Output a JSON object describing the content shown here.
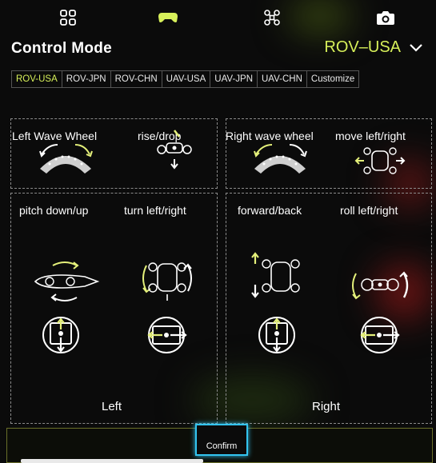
{
  "header": {
    "title": "Control Mode",
    "mode_value": "ROV–USA"
  },
  "top_icons": [
    "grid-icon",
    "gamepad-icon",
    "drone-icon",
    "camera-icon"
  ],
  "tabs": [
    {
      "label": "ROV-USA",
      "active": true
    },
    {
      "label": "ROV-JPN",
      "active": false
    },
    {
      "label": "ROV-CHN",
      "active": false
    },
    {
      "label": "UAV-USA",
      "active": false
    },
    {
      "label": "UAV-JPN",
      "active": false
    },
    {
      "label": "UAV-CHN",
      "active": false
    },
    {
      "label": "Customize",
      "active": false
    }
  ],
  "top_left_box": {
    "label_1": "Left Wave Wheel",
    "label_2": "rise/drop"
  },
  "top_right_box": {
    "label_1": "Right wave wheel",
    "label_2": "move left/right"
  },
  "left_box": {
    "label_1": "pitch down/up",
    "label_2": "turn left/right",
    "side_label": "Left"
  },
  "right_box": {
    "label_1": "forward/back",
    "label_2": "roll left/right",
    "side_label": "Right"
  },
  "footer": {
    "confirm_label": "Confirm"
  },
  "colors": {
    "accent": "#d7f05a",
    "focus": "#33c4f0",
    "background": "#0b0b0b"
  }
}
